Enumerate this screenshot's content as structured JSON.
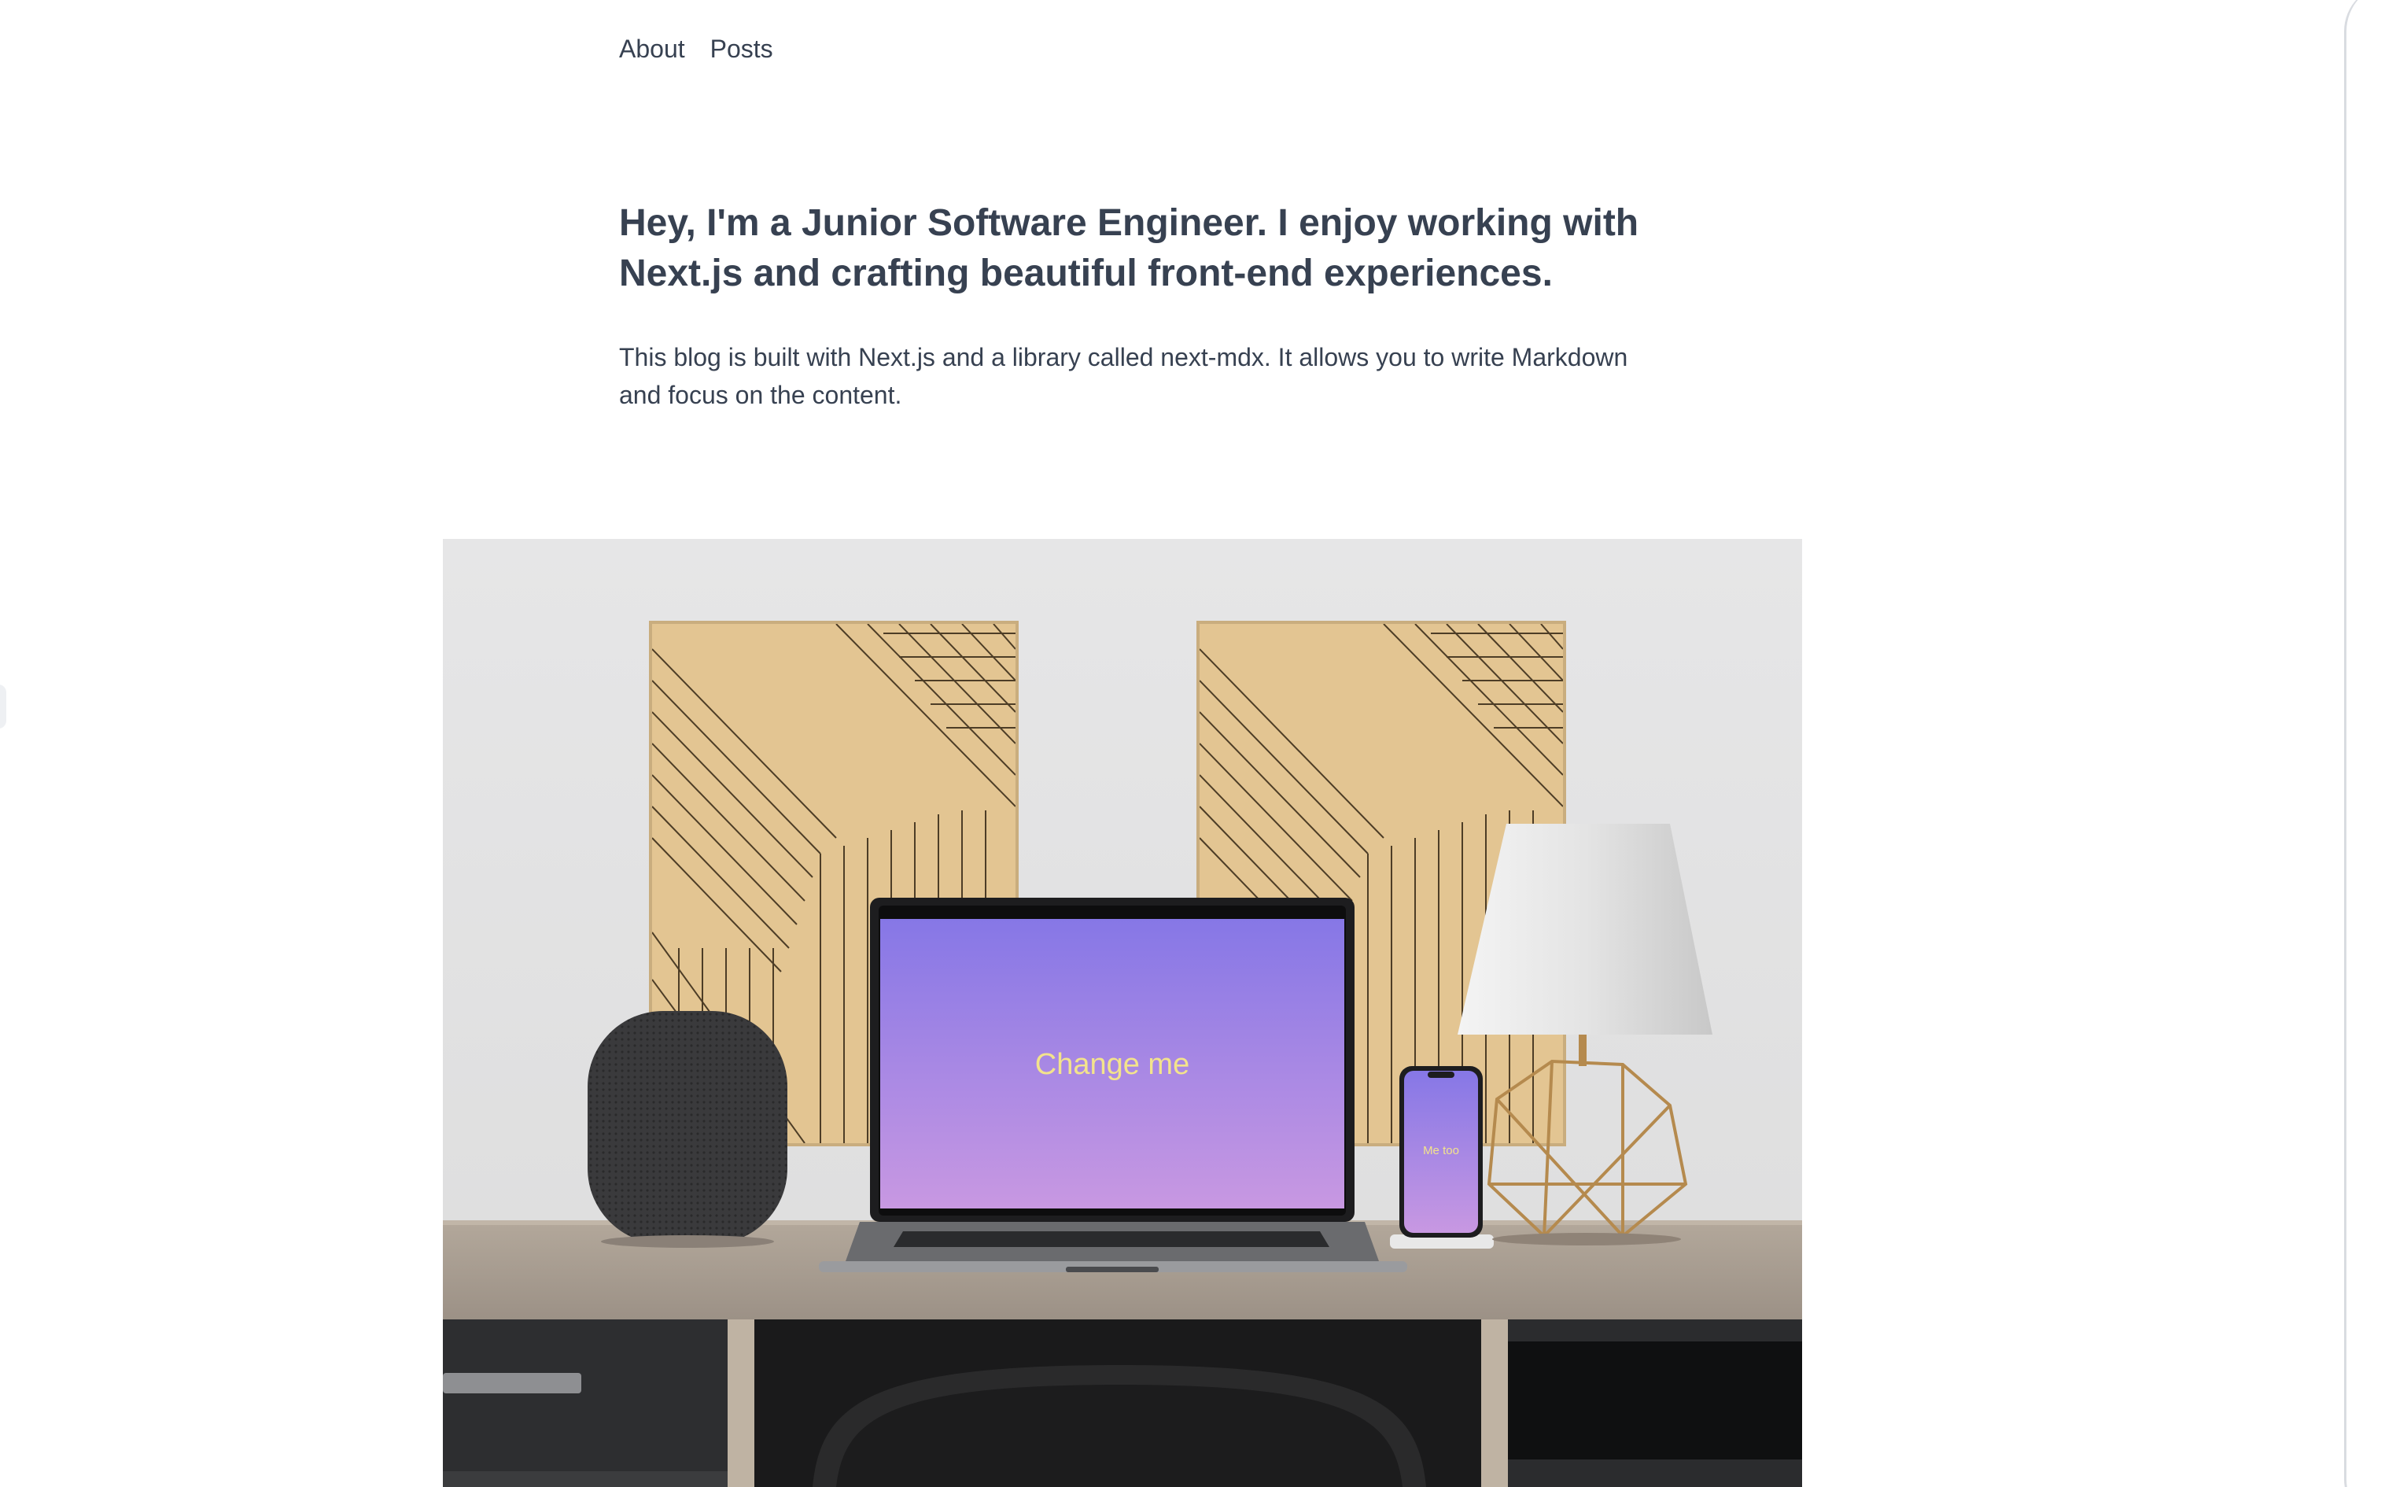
{
  "nav": {
    "items": [
      {
        "label": "About"
      },
      {
        "label": "Posts"
      }
    ]
  },
  "hero": {
    "title": "Hey, I'm a Junior Software Engineer. I enjoy working with Next.js and crafting beautiful front-end experiences.",
    "description": "This blog is built with Next.js and a library called next-mdx. It allows you to write Markdown and focus on the content."
  },
  "image": {
    "laptop_screen_text": "Change me",
    "phone_screen_text": "Me too"
  },
  "colors": {
    "text": "#374151",
    "screen_top": "#8677e6",
    "screen_bottom": "#c898e2",
    "screen_text": "#f3e38c",
    "wood_panel": "#e3c592",
    "desk": "#a79d91"
  }
}
